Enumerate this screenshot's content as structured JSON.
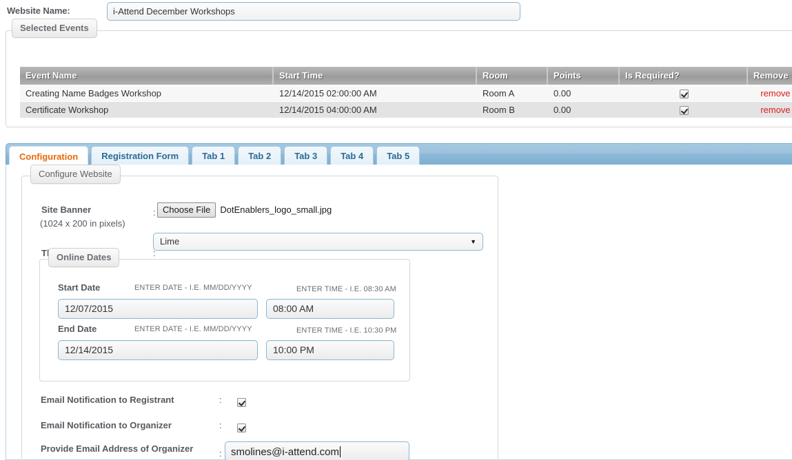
{
  "website_name": {
    "label": "Website Name:",
    "value": "i-Attend December Workshops",
    "placeholder": ""
  },
  "selected_events": {
    "legend": "Selected Events",
    "columns": [
      "Event Name",
      "Start Time",
      "Room",
      "Points",
      "Is Required?",
      "Remove"
    ],
    "rows": [
      {
        "event_name": "Creating Name Badges Workshop",
        "start_time": "12/14/2015 02:00:00 AM",
        "room": "Room A",
        "points": "0.00",
        "is_required": true,
        "remove_label": "remove"
      },
      {
        "event_name": "Certificate Workshop",
        "start_time": "12/14/2015 04:00:00 AM",
        "room": "Room B",
        "points": "0.00",
        "is_required": true,
        "remove_label": "remove"
      }
    ]
  },
  "tabs": {
    "items": [
      {
        "label": "Configuration",
        "active": true
      },
      {
        "label": "Registration Form",
        "active": false
      },
      {
        "label": "Tab 1",
        "active": false
      },
      {
        "label": "Tab 2",
        "active": false
      },
      {
        "label": "Tab 3",
        "active": false
      },
      {
        "label": "Tab 4",
        "active": false
      },
      {
        "label": "Tab 5",
        "active": false
      }
    ],
    "active_color": "#e8690a",
    "inactive_color": "#2b6a94"
  },
  "configure_website": {
    "legend": "Configure Website",
    "site_banner": {
      "label": "Site Banner",
      "colon": ":",
      "button_label": "Choose File",
      "file_name": "DotEnablers_logo_small.jpg",
      "dimension_note": "(1024 x 200 in pixels)"
    },
    "theme_color": {
      "label": "Theme Color",
      "colon": ":",
      "value": "Lime",
      "arrow": "▼"
    },
    "online_dates": {
      "legend": "Online Dates",
      "date_hint": "ENTER DATE - I.E. MM/DD/YYYY",
      "start": {
        "label": "Start Date",
        "time_hint": "ENTER TIME - I.E. 08:30 AM",
        "date_value": "12/07/2015",
        "time_value": "08:00 AM"
      },
      "end": {
        "label": "End Date",
        "time_hint": "ENTER TIME - I.E. 10:30 PM",
        "date_value": "12/14/2015",
        "time_value": "10:00 PM"
      }
    },
    "email_registrant": {
      "label": "Email Notification to Registrant",
      "colon": ":",
      "checked": true
    },
    "email_organizer": {
      "label": "Email Notification to Organizer",
      "colon": ":",
      "checked": true
    },
    "organizer_email": {
      "label": "Provide Email Address of Organizer",
      "colon": ":",
      "value": "smolines@i-attend.com"
    }
  }
}
